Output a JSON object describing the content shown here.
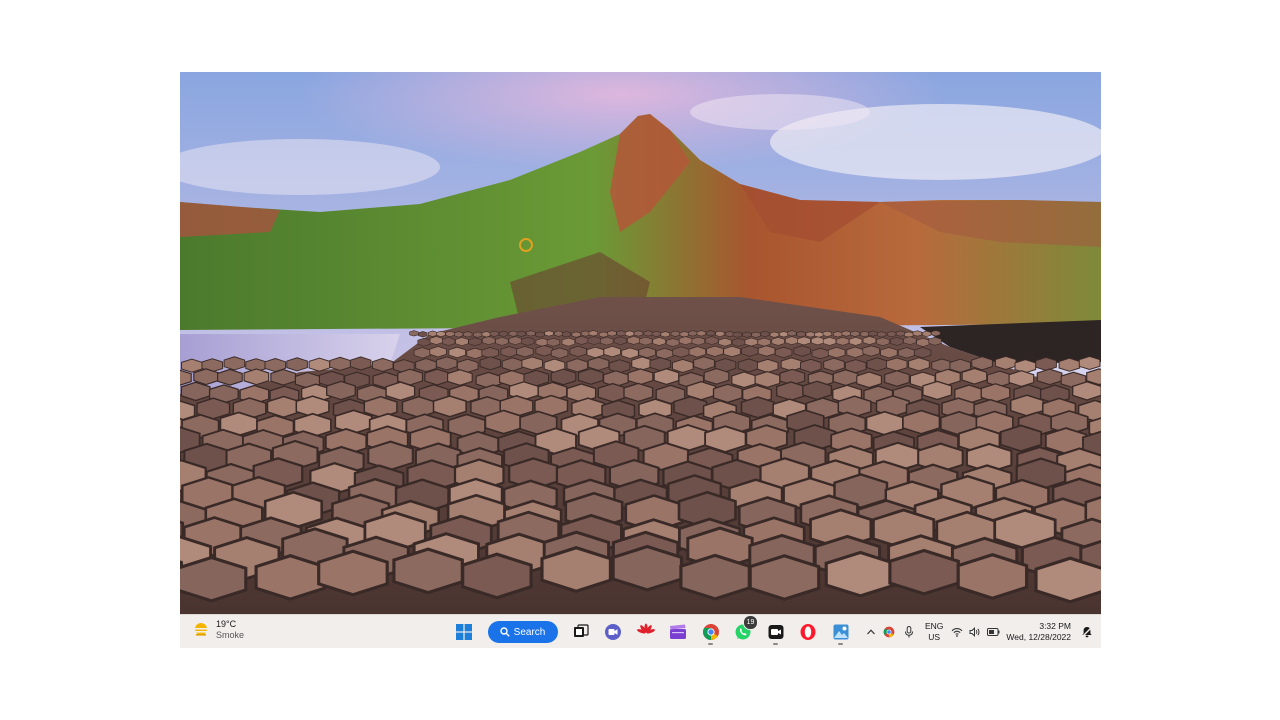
{
  "desktop": {
    "wallpaper": "Giant's Causeway basalt columns at sunset",
    "colors": {
      "sky_top": "#9fb3e6",
      "sky_pink": "#e4c3dc",
      "hill_green": "#5d8a34",
      "cliff_red": "#b35a3a",
      "rock": "#8a6a62",
      "water": "#b3a9d6"
    }
  },
  "taskbar": {
    "weather": {
      "temperature": "19°C",
      "condition": "Smoke",
      "icon": "haze-sun-icon"
    },
    "search": {
      "label": "Search",
      "icon": "search-icon"
    },
    "apps": [
      {
        "name": "Start",
        "icon": "windows-start-icon"
      },
      {
        "name": "Task View",
        "icon": "task-view-icon"
      },
      {
        "name": "Meet",
        "icon": "video-chat-icon"
      },
      {
        "name": "Huawei",
        "icon": "huawei-icon"
      },
      {
        "name": "Clapper",
        "icon": "clapperboard-icon"
      },
      {
        "name": "Chrome",
        "icon": "chrome-icon"
      },
      {
        "name": "WhatsApp",
        "icon": "whatsapp-icon",
        "badge": "19"
      },
      {
        "name": "Camera app",
        "icon": "camera-app-icon"
      },
      {
        "name": "Opera",
        "icon": "opera-icon"
      },
      {
        "name": "Photo editor",
        "icon": "photo-editor-icon"
      }
    ],
    "tray": {
      "language_line1": "ENG",
      "language_line2": "US",
      "time": "3:32 PM",
      "date": "Wed, 12/28/2022"
    },
    "colors": {
      "background": "#f1eeec",
      "accent": "#1a73e8"
    }
  }
}
